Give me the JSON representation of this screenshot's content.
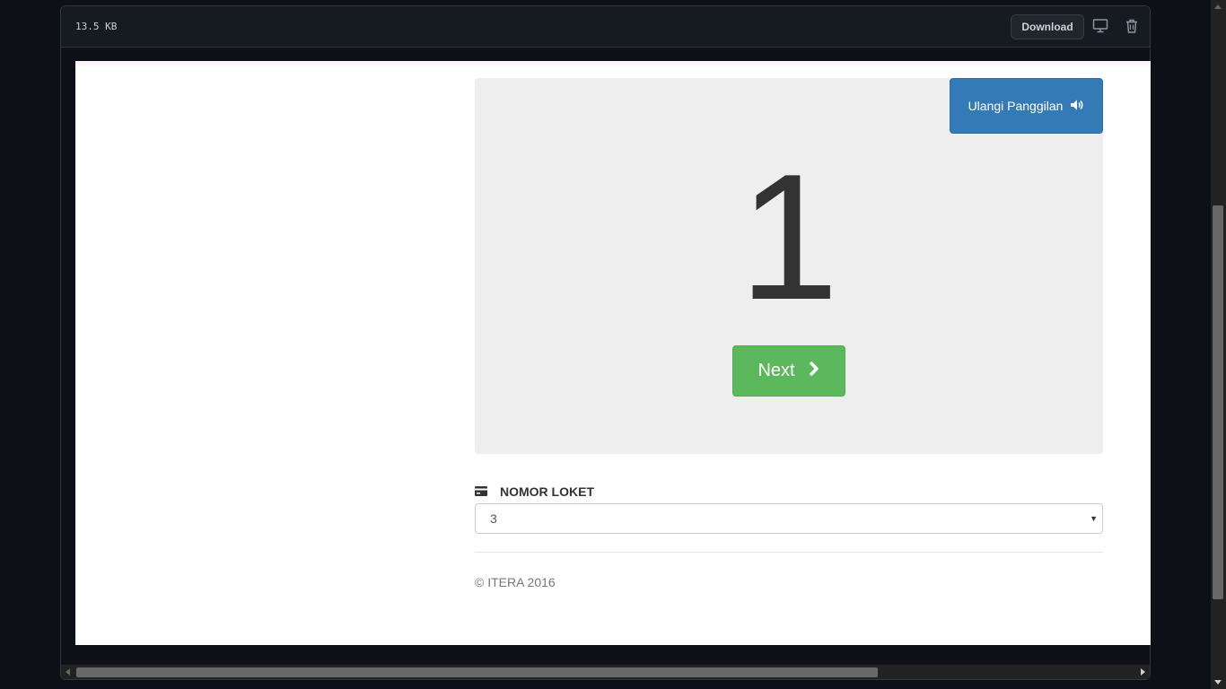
{
  "file_header": {
    "size": "13.5 KB",
    "download_label": "Download",
    "desktop_icon": "desktop-icon",
    "trash_icon": "trash-icon"
  },
  "queue_panel": {
    "repeat_call_label": "Ulangi Panggilan",
    "repeat_call_icon": "volume-icon",
    "current_number": "1",
    "next_label": "Next",
    "next_icon": "chevron-right-icon"
  },
  "counter": {
    "label": "NOMOR LOKET",
    "icon": "credit-card-icon",
    "selected": "3"
  },
  "footer": {
    "text": "© ITERA 2016"
  },
  "colors": {
    "repeat_button": "#337ab7",
    "next_button": "#5cb85c",
    "panel_bg": "#eeeeee",
    "page_bg": "#0d1117"
  }
}
